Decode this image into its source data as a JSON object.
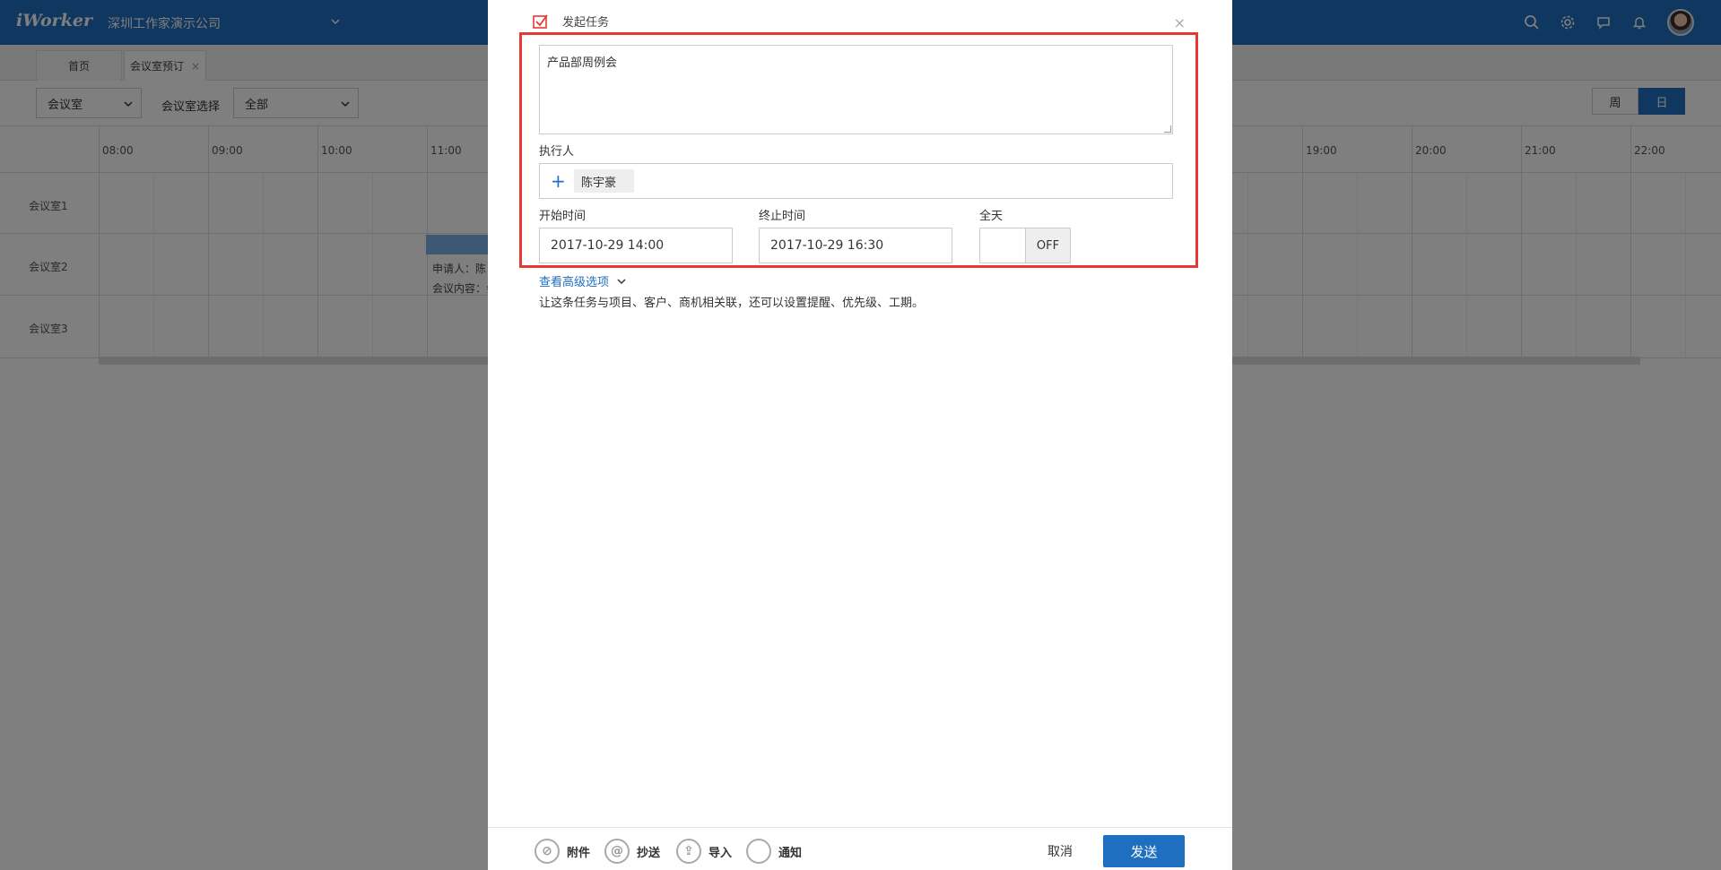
{
  "app": {
    "logo": "iWorker",
    "company": "深圳工作家演示公司"
  },
  "tabs": [
    {
      "label": "首页"
    },
    {
      "label": "会议室预订",
      "close": "×"
    }
  ],
  "filters": {
    "room_type": "会议室",
    "room_select_label": "会议室选择",
    "room_select_value": "全部",
    "view_week": "周",
    "view_day": "日"
  },
  "calendar": {
    "hours": [
      "08:00",
      "09:00",
      "10:00",
      "11:00",
      "19:00",
      "20:00",
      "21:00",
      "22:00"
    ],
    "rooms": [
      "会议室1",
      "会议室2",
      "会议室3"
    ],
    "booking": {
      "applicant": "申请人：陈",
      "content": "会议内容：会"
    }
  },
  "modal": {
    "title": "发起任务",
    "close": "×",
    "task_text": "产品部周例会",
    "assignee_label": "执行人",
    "assignee": "陈宇豪",
    "start_label": "开始时间",
    "start_value": "2017-10-29 14:00",
    "end_label": "终止时间",
    "end_value": "2017-10-29 16:30",
    "allday_label": "全天",
    "allday_value": "OFF",
    "advanced_link": "查看高级选项",
    "hint": "让这条任务与项目、客户、商机相关联，还可以设置提醒、优先级、工期。",
    "footer": {
      "attach": "附件",
      "cc": "抄送",
      "import": "导入",
      "notify": "通知",
      "cancel": "取消",
      "send": "发送"
    }
  },
  "colors": {
    "primary": "#1e6fbf",
    "highlight": "#e53935"
  }
}
